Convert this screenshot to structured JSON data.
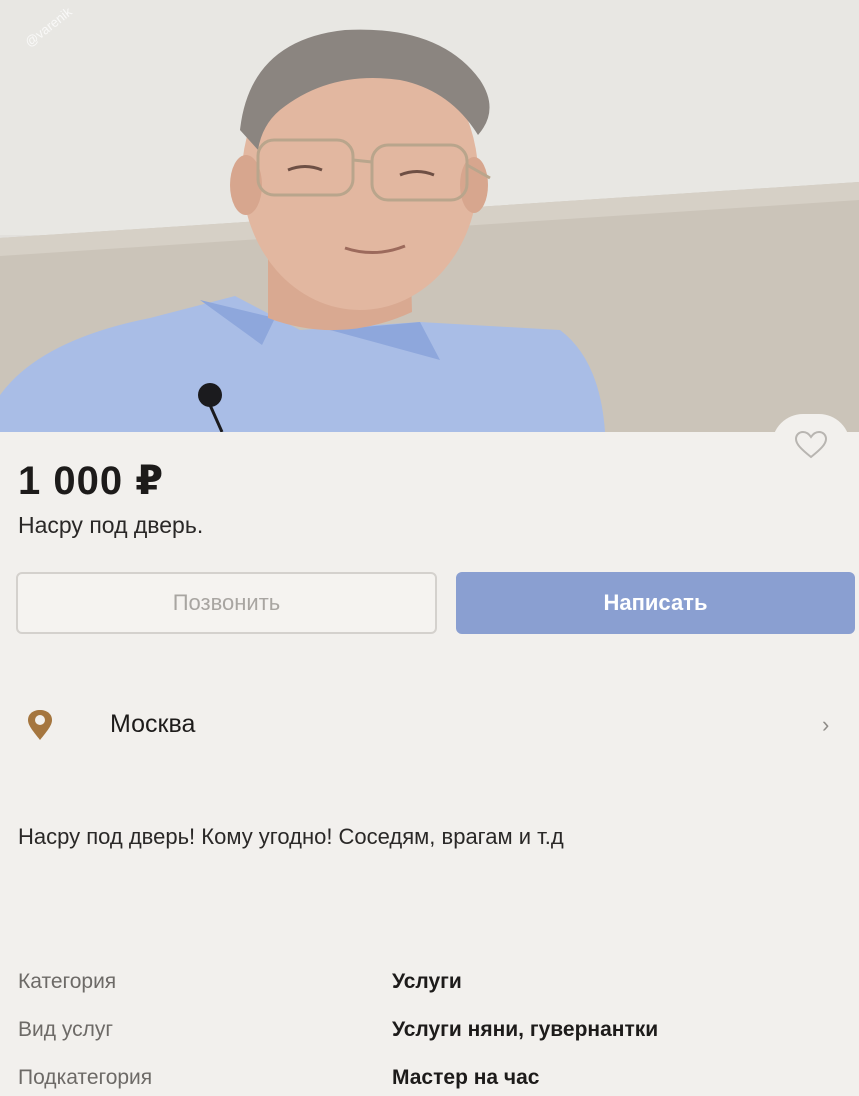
{
  "listing": {
    "price": "1 000 ₽",
    "title": "Насру под дверь.",
    "watermark": "@varenik",
    "description": "Насру под дверь! Кому угодно! Соседям, врагам и т.д"
  },
  "actions": {
    "call_label": "Позвонить",
    "write_label": "Написать"
  },
  "location": {
    "city": "Москва",
    "chevron": "›"
  },
  "params": [
    {
      "label": "Категория",
      "value": "Услуги"
    },
    {
      "label": "Вид услуг",
      "value": "Услуги няни, гувернантки"
    },
    {
      "label": "Подкатегория",
      "value": "Мастер на час"
    }
  ],
  "colors": {
    "accent": "#8a9fd1",
    "pin": "#a5763f"
  },
  "icons": {
    "favorite": "heart-icon",
    "location": "map-pin-icon",
    "chevron": "chevron-right-icon"
  }
}
